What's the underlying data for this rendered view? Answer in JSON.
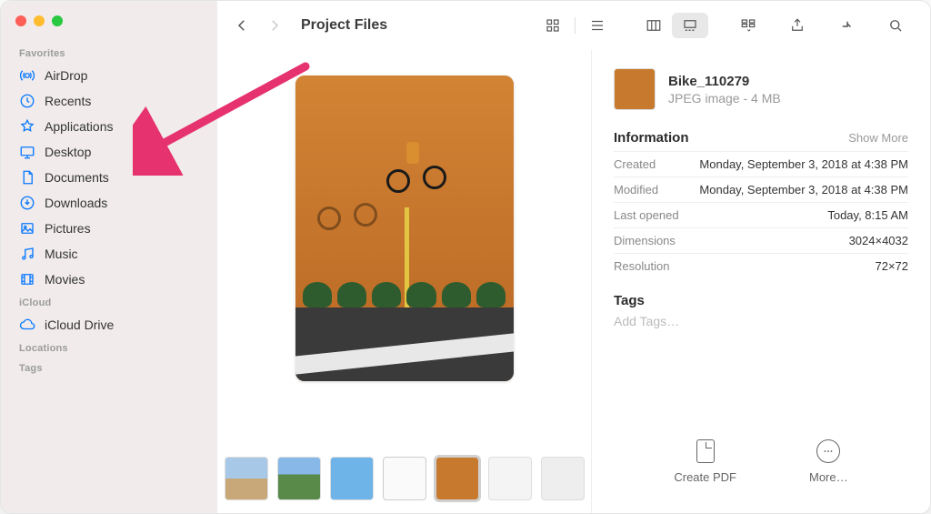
{
  "window_title": "Project Files",
  "sidebar": {
    "sections": [
      {
        "title": "Favorites",
        "items": [
          {
            "icon": "airdrop",
            "label": "AirDrop"
          },
          {
            "icon": "clock",
            "label": "Recents"
          },
          {
            "icon": "apps",
            "label": "Applications"
          },
          {
            "icon": "desktop",
            "label": "Desktop"
          },
          {
            "icon": "doc",
            "label": "Documents"
          },
          {
            "icon": "download",
            "label": "Downloads"
          },
          {
            "icon": "pictures",
            "label": "Pictures"
          },
          {
            "icon": "music",
            "label": "Music"
          },
          {
            "icon": "movies",
            "label": "Movies"
          }
        ]
      },
      {
        "title": "iCloud",
        "items": [
          {
            "icon": "cloud",
            "label": "iCloud Drive"
          }
        ]
      },
      {
        "title": "Locations",
        "items": []
      },
      {
        "title": "Tags",
        "items": []
      }
    ]
  },
  "file": {
    "name": "Bike_110279",
    "type_line": "JPEG image - 4 MB",
    "info_heading": "Information",
    "show_more": "Show More",
    "info": [
      {
        "label": "Created",
        "value": "Monday, September 3, 2018 at 4:38 PM"
      },
      {
        "label": "Modified",
        "value": "Monday, September 3, 2018 at 4:38 PM"
      },
      {
        "label": "Last opened",
        "value": "Today, 8:15 AM"
      },
      {
        "label": "Dimensions",
        "value": "3024×4032"
      },
      {
        "label": "Resolution",
        "value": "72×72"
      }
    ],
    "tags_heading": "Tags",
    "tags_placeholder": "Add Tags…"
  },
  "actions": {
    "create_pdf": "Create PDF",
    "more": "More…"
  },
  "annotation": {
    "target": "Applications",
    "color": "#e6326e"
  }
}
